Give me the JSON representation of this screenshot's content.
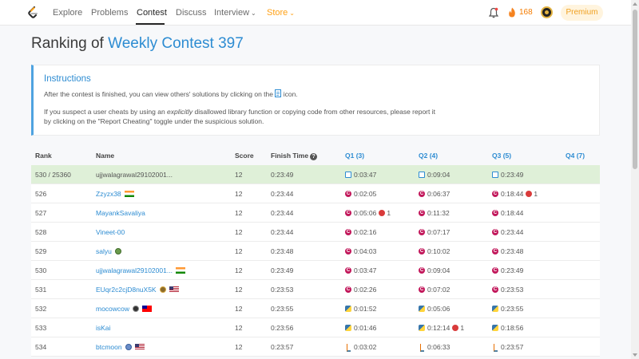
{
  "nav": {
    "items": [
      {
        "label": "Explore"
      },
      {
        "label": "Problems"
      },
      {
        "label": "Contest"
      },
      {
        "label": "Discuss"
      },
      {
        "label": "Interview"
      },
      {
        "label": "Store"
      }
    ],
    "fire_count": "168",
    "premium_label": "Premium",
    "colors": {
      "accent": "#ffa116",
      "link": "#2d8cd2"
    }
  },
  "page": {
    "title_prefix": "Ranking of",
    "title_contest": "Weekly Contest 397"
  },
  "instructions": {
    "title": "Instructions",
    "p1_before": "After the contest is finished, you can view others' solutions by clicking on the",
    "p1_after": "icon.",
    "p2_before": "If you suspect a user cheats by using an",
    "p2_emphasis": "explicitly",
    "p2_after": "disallowed library function or copying code from other resources, please report it by clicking on the \"Report Cheating\" toggle under the suspicious solution."
  },
  "table": {
    "headers": {
      "rank": "Rank",
      "name": "Name",
      "score": "Score",
      "finish_time": "Finish Time",
      "q1": "Q1 (3)",
      "q2": "Q2 (4)",
      "q3": "Q3 (5)",
      "q4": "Q4 (7)"
    },
    "rows": [
      {
        "rank": "530 / 25360",
        "name": "ujjwalagrawal29102001...",
        "score": "12",
        "finish": "0:23:49",
        "q1": "0:03:47",
        "q1_lang": "doc",
        "q2": "0:09:04",
        "q2_lang": "doc",
        "q3": "0:23:49",
        "q3_lang": "doc",
        "q3_bugs": ""
      },
      {
        "rank": "526",
        "name": "Zzyzx38",
        "score": "12",
        "finish": "0:23:44",
        "q1": "0:02:05",
        "q1_lang": "c",
        "q2": "0:06:37",
        "q2_lang": "c",
        "q3": "0:18:44",
        "q3_lang": "c",
        "q3_bugs": "1"
      },
      {
        "rank": "527",
        "name": "MayankSavaliya",
        "score": "12",
        "finish": "0:23:44",
        "q1": "0:05:06",
        "q1_lang": "c",
        "q1_bugs": "1",
        "q2": "0:11:32",
        "q2_lang": "c",
        "q3": "0:18:44",
        "q3_lang": "c",
        "q3_bugs": ""
      },
      {
        "rank": "528",
        "name": "Vineet-00",
        "score": "12",
        "finish": "0:23:44",
        "q1": "0:02:16",
        "q1_lang": "c",
        "q2": "0:07:17",
        "q2_lang": "c",
        "q3": "0:23:44",
        "q3_lang": "c",
        "q3_bugs": ""
      },
      {
        "rank": "529",
        "name": "salyu",
        "score": "12",
        "finish": "0:23:48",
        "q1": "0:04:03",
        "q1_lang": "c",
        "q2": "0:10:02",
        "q2_lang": "c",
        "q3": "0:23:48",
        "q3_lang": "c",
        "q3_bugs": ""
      },
      {
        "rank": "530",
        "name": "ujjwalagrawal29102001...",
        "score": "12",
        "finish": "0:23:49",
        "q1": "0:03:47",
        "q1_lang": "c",
        "q2": "0:09:04",
        "q2_lang": "c",
        "q3": "0:23:49",
        "q3_lang": "c",
        "q3_bugs": ""
      },
      {
        "rank": "531",
        "name": "EUqr2c2cjD8nuX5K",
        "score": "12",
        "finish": "0:23:53",
        "q1": "0:02:26",
        "q1_lang": "c",
        "q2": "0:07:02",
        "q2_lang": "c",
        "q3": "0:23:53",
        "q3_lang": "c",
        "q3_bugs": ""
      },
      {
        "rank": "532",
        "name": "mocowcow",
        "score": "12",
        "finish": "0:23:55",
        "q1": "0:01:52",
        "q1_lang": "py",
        "q2": "0:05:06",
        "q2_lang": "py",
        "q3": "0:23:55",
        "q3_lang": "py",
        "q3_bugs": ""
      },
      {
        "rank": "533",
        "name": "isKai",
        "score": "12",
        "finish": "0:23:56",
        "q1": "0:01:46",
        "q1_lang": "py",
        "q2": "0:12:14",
        "q2_lang": "py",
        "q2_bugs": "1",
        "q3": "0:18:56",
        "q3_lang": "py",
        "q3_bugs": ""
      },
      {
        "rank": "534",
        "name": "btcmoon",
        "score": "12",
        "finish": "0:23:57",
        "q1": "0:03:02",
        "q1_lang": "java",
        "q2": "0:06:33",
        "q2_lang": "java",
        "q3": "0:23:57",
        "q3_lang": "java",
        "q3_bugs": ""
      }
    ]
  }
}
